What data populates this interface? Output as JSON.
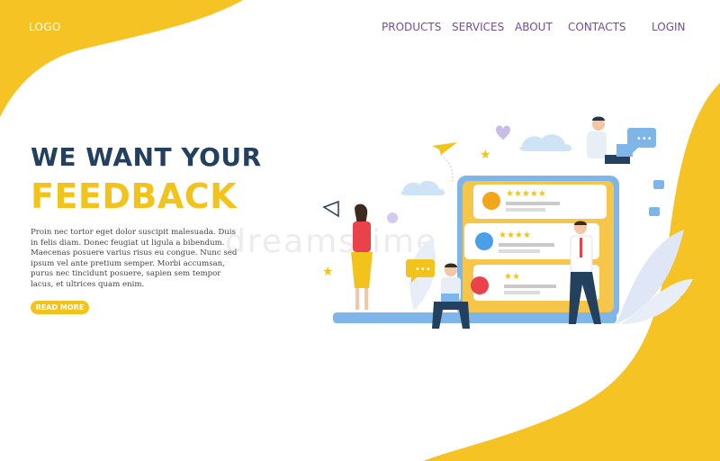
{
  "header": {
    "logo": "LOGO",
    "nav": [
      "PRODUCTS",
      "SERVICES",
      "ABOUT",
      "CONTACTS",
      "LOGIN"
    ]
  },
  "hero": {
    "title_line1": "WE WANT YOUR",
    "title_line2": "FEEDBACK",
    "description": "Proin nec tortor eget dolor suscipit malesuada. Duis in felis diam. Donec feugiat ut ligula a bibendum. Maecenas posuere varius risus eu congue. Nunc sed ipsum vel ante pretium semper. Morbi accumsan, purus nec tincidunt posuere, sapien sem tempor lacus, et ultrices quam enim.",
    "cta": "READ MORE"
  },
  "watermark": "dreamstime",
  "colors": {
    "accent_yellow": "#f2c31b",
    "title_navy": "#23415e",
    "nav_purple": "#7a4a96",
    "screen_blue": "#7fb6ea"
  },
  "illustration": {
    "cards": [
      {
        "rating": 5,
        "icon": "orange-circle-icon"
      },
      {
        "rating": 4,
        "icon": "blue-circle-icon"
      },
      {
        "rating": 2,
        "icon": "red-circle-icon"
      }
    ]
  }
}
